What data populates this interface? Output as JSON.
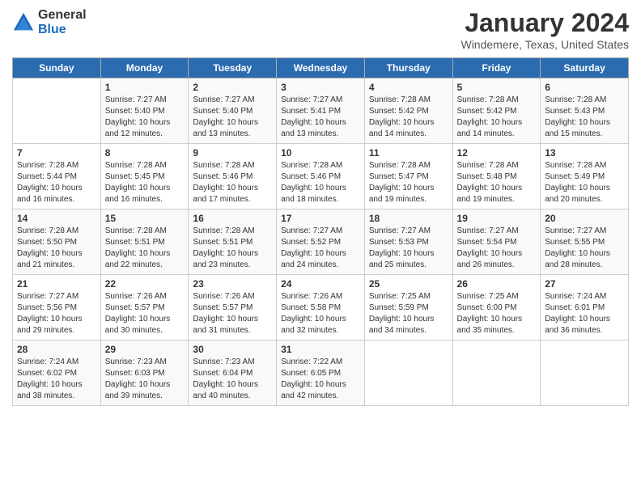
{
  "logo": {
    "general": "General",
    "blue": "Blue"
  },
  "title": "January 2024",
  "subtitle": "Windemere, Texas, United States",
  "days_of_week": [
    "Sunday",
    "Monday",
    "Tuesday",
    "Wednesday",
    "Thursday",
    "Friday",
    "Saturday"
  ],
  "weeks": [
    [
      {
        "day": "",
        "info": ""
      },
      {
        "day": "1",
        "info": "Sunrise: 7:27 AM\nSunset: 5:40 PM\nDaylight: 10 hours\nand 12 minutes."
      },
      {
        "day": "2",
        "info": "Sunrise: 7:27 AM\nSunset: 5:40 PM\nDaylight: 10 hours\nand 13 minutes."
      },
      {
        "day": "3",
        "info": "Sunrise: 7:27 AM\nSunset: 5:41 PM\nDaylight: 10 hours\nand 13 minutes."
      },
      {
        "day": "4",
        "info": "Sunrise: 7:28 AM\nSunset: 5:42 PM\nDaylight: 10 hours\nand 14 minutes."
      },
      {
        "day": "5",
        "info": "Sunrise: 7:28 AM\nSunset: 5:42 PM\nDaylight: 10 hours\nand 14 minutes."
      },
      {
        "day": "6",
        "info": "Sunrise: 7:28 AM\nSunset: 5:43 PM\nDaylight: 10 hours\nand 15 minutes."
      }
    ],
    [
      {
        "day": "7",
        "info": "Sunrise: 7:28 AM\nSunset: 5:44 PM\nDaylight: 10 hours\nand 16 minutes."
      },
      {
        "day": "8",
        "info": "Sunrise: 7:28 AM\nSunset: 5:45 PM\nDaylight: 10 hours\nand 16 minutes."
      },
      {
        "day": "9",
        "info": "Sunrise: 7:28 AM\nSunset: 5:46 PM\nDaylight: 10 hours\nand 17 minutes."
      },
      {
        "day": "10",
        "info": "Sunrise: 7:28 AM\nSunset: 5:46 PM\nDaylight: 10 hours\nand 18 minutes."
      },
      {
        "day": "11",
        "info": "Sunrise: 7:28 AM\nSunset: 5:47 PM\nDaylight: 10 hours\nand 19 minutes."
      },
      {
        "day": "12",
        "info": "Sunrise: 7:28 AM\nSunset: 5:48 PM\nDaylight: 10 hours\nand 19 minutes."
      },
      {
        "day": "13",
        "info": "Sunrise: 7:28 AM\nSunset: 5:49 PM\nDaylight: 10 hours\nand 20 minutes."
      }
    ],
    [
      {
        "day": "14",
        "info": "Sunrise: 7:28 AM\nSunset: 5:50 PM\nDaylight: 10 hours\nand 21 minutes."
      },
      {
        "day": "15",
        "info": "Sunrise: 7:28 AM\nSunset: 5:51 PM\nDaylight: 10 hours\nand 22 minutes."
      },
      {
        "day": "16",
        "info": "Sunrise: 7:28 AM\nSunset: 5:51 PM\nDaylight: 10 hours\nand 23 minutes."
      },
      {
        "day": "17",
        "info": "Sunrise: 7:27 AM\nSunset: 5:52 PM\nDaylight: 10 hours\nand 24 minutes."
      },
      {
        "day": "18",
        "info": "Sunrise: 7:27 AM\nSunset: 5:53 PM\nDaylight: 10 hours\nand 25 minutes."
      },
      {
        "day": "19",
        "info": "Sunrise: 7:27 AM\nSunset: 5:54 PM\nDaylight: 10 hours\nand 26 minutes."
      },
      {
        "day": "20",
        "info": "Sunrise: 7:27 AM\nSunset: 5:55 PM\nDaylight: 10 hours\nand 28 minutes."
      }
    ],
    [
      {
        "day": "21",
        "info": "Sunrise: 7:27 AM\nSunset: 5:56 PM\nDaylight: 10 hours\nand 29 minutes."
      },
      {
        "day": "22",
        "info": "Sunrise: 7:26 AM\nSunset: 5:57 PM\nDaylight: 10 hours\nand 30 minutes."
      },
      {
        "day": "23",
        "info": "Sunrise: 7:26 AM\nSunset: 5:57 PM\nDaylight: 10 hours\nand 31 minutes."
      },
      {
        "day": "24",
        "info": "Sunrise: 7:26 AM\nSunset: 5:58 PM\nDaylight: 10 hours\nand 32 minutes."
      },
      {
        "day": "25",
        "info": "Sunrise: 7:25 AM\nSunset: 5:59 PM\nDaylight: 10 hours\nand 34 minutes."
      },
      {
        "day": "26",
        "info": "Sunrise: 7:25 AM\nSunset: 6:00 PM\nDaylight: 10 hours\nand 35 minutes."
      },
      {
        "day": "27",
        "info": "Sunrise: 7:24 AM\nSunset: 6:01 PM\nDaylight: 10 hours\nand 36 minutes."
      }
    ],
    [
      {
        "day": "28",
        "info": "Sunrise: 7:24 AM\nSunset: 6:02 PM\nDaylight: 10 hours\nand 38 minutes."
      },
      {
        "day": "29",
        "info": "Sunrise: 7:23 AM\nSunset: 6:03 PM\nDaylight: 10 hours\nand 39 minutes."
      },
      {
        "day": "30",
        "info": "Sunrise: 7:23 AM\nSunset: 6:04 PM\nDaylight: 10 hours\nand 40 minutes."
      },
      {
        "day": "31",
        "info": "Sunrise: 7:22 AM\nSunset: 6:05 PM\nDaylight: 10 hours\nand 42 minutes."
      },
      {
        "day": "",
        "info": ""
      },
      {
        "day": "",
        "info": ""
      },
      {
        "day": "",
        "info": ""
      }
    ]
  ]
}
